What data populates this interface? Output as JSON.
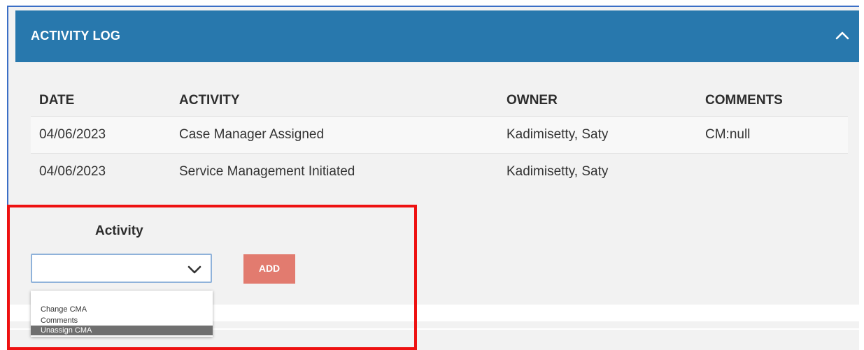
{
  "header": {
    "title": "ACTIVITY LOG",
    "collapse_icon": "chevron-up-icon"
  },
  "table": {
    "columns": [
      "DATE",
      "ACTIVITY",
      "OWNER",
      "COMMENTS"
    ],
    "rows": [
      {
        "date": "04/06/2023",
        "activity": "Case Manager Assigned",
        "owner": "Kadimisetty, Saty",
        "comments": "CM:null"
      },
      {
        "date": "04/06/2023",
        "activity": "Service Management Initiated",
        "owner": "Kadimisetty, Saty",
        "comments": ""
      }
    ]
  },
  "form": {
    "activity_label": "Activity",
    "select_value": "",
    "add_label": "ADD",
    "options": [
      "Change CMA",
      "Comments",
      "Unassign CMA"
    ],
    "highlighted_option": "Unassign CMA"
  },
  "colors": {
    "header": "#2878ad",
    "add_button": "#e27b6f",
    "highlight": "#ee1111"
  }
}
